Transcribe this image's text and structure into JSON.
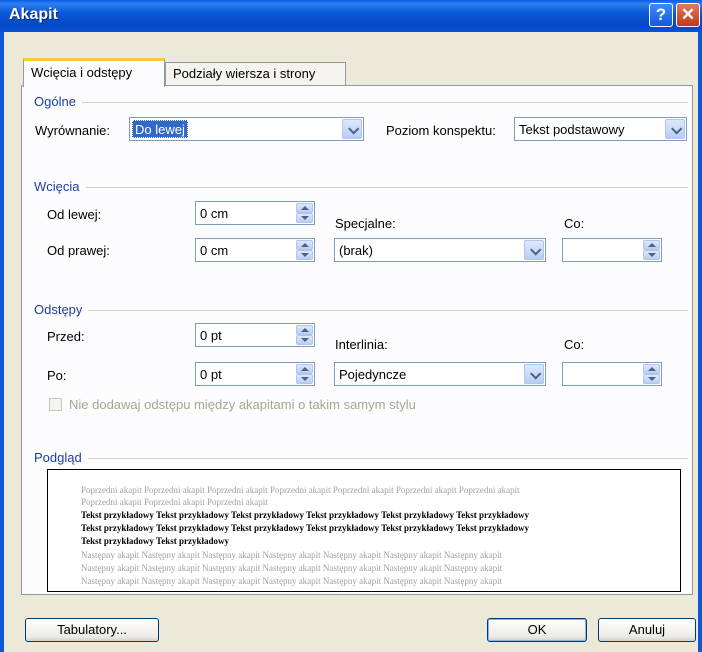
{
  "window": {
    "title": "Akapit",
    "help_glyph": "?",
    "close_glyph": "✕"
  },
  "tabs": [
    {
      "label": "Wcięcia i odstępy",
      "active": true
    },
    {
      "label": "Podziały wiersza i strony",
      "active": false
    }
  ],
  "general": {
    "heading": "Ogólne",
    "alignment_label": "Wyrównanie:",
    "alignment_value": "Do lewej",
    "outline_label": "Poziom konspektu:",
    "outline_value": "Tekst podstawowy"
  },
  "indents": {
    "heading": "Wcięcia",
    "left_label": "Od lewej:",
    "left_value": "0 cm",
    "right_label": "Od prawej:",
    "right_value": "0 cm",
    "special_label": "Specjalne:",
    "special_value": "(brak)",
    "by_label": "Co:",
    "by_value": ""
  },
  "spacing": {
    "heading": "Odstępy",
    "before_label": "Przed:",
    "before_value": "0 pt",
    "after_label": "Po:",
    "after_value": "0 pt",
    "line_label": "Interlinia:",
    "line_value": "Pojedyncze",
    "at_label": "Co:",
    "at_value": "",
    "no_space_checkbox": "Nie dodawaj odstępu między akapitami o takim samym stylu"
  },
  "preview": {
    "heading": "Podgląd",
    "prev_line1": "Poprzedni akapit Poprzedni akapit Poprzedni akapit Poprzedni akapit Poprzedni akapit Poprzedni akapit Poprzedni akapit",
    "prev_line2": "Poprzedni akapit Poprzedni akapit Poprzedni akapit",
    "cur_line1": "Tekst przykładowy Tekst przykładowy Tekst przykładowy Tekst przykładowy Tekst przykładowy Tekst przykładowy",
    "cur_line2": "Tekst przykładowy Tekst przykładowy Tekst przykładowy Tekst przykładowy Tekst przykładowy Tekst przykładowy",
    "cur_line3": "Tekst przykładowy Tekst przykładowy",
    "next_line1": "Następny akapit Następny akapit Następny akapit Następny akapit Następny akapit Następny akapit Następny akapit",
    "next_line2": "Następny akapit Następny akapit Następny akapit Następny akapit Następny akapit Następny akapit Następny akapit",
    "next_line3": "Następny akapit Następny akapit Następny akapit Następny akapit Następny akapit Następny akapit Następny akapit"
  },
  "buttons": {
    "tabs": "Tabulatory...",
    "ok": "OK",
    "cancel": "Anuluj"
  },
  "colors": {
    "title_bar": "#0b58d8",
    "group_heading": "#1e3e9e",
    "selection": "#316ac5"
  }
}
